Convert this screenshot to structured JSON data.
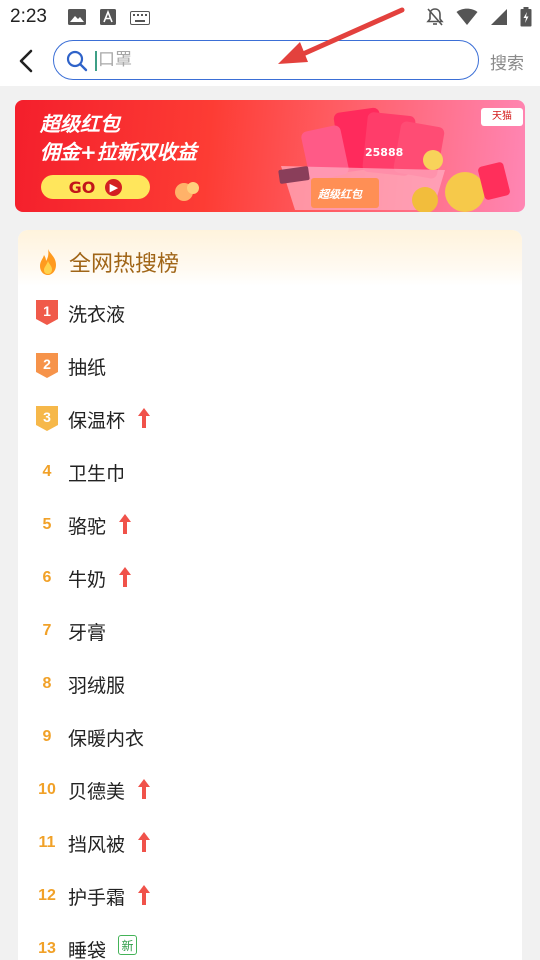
{
  "status_bar": {
    "time": "2:23",
    "left_icons": [
      "image-icon",
      "font-download-icon",
      "keyboard-icon"
    ],
    "right_icons": [
      "bell-off-icon",
      "wifi-icon",
      "signal-icon",
      "battery-charging-icon"
    ]
  },
  "top_bar": {
    "back_icon": "chevron-left-icon",
    "search_placeholder": "口罩",
    "search_value": "",
    "search_button_label": "搜索"
  },
  "banner": {
    "line1": "超级红包",
    "line2": "佣金+拉新双收益",
    "go_label": "GO",
    "amount_text": "25888",
    "cart_label": "超级红包",
    "logo_text": "天猫"
  },
  "hot_list": {
    "title": "全网热搜榜",
    "items": [
      {
        "rank": "1",
        "label": "洗衣液",
        "badge": "top",
        "trend": ""
      },
      {
        "rank": "2",
        "label": "抽纸",
        "badge": "top",
        "trend": ""
      },
      {
        "rank": "3",
        "label": "保温杯",
        "badge": "top",
        "trend": "up"
      },
      {
        "rank": "4",
        "label": "卫生巾",
        "badge": "",
        "trend": ""
      },
      {
        "rank": "5",
        "label": "骆驼",
        "badge": "",
        "trend": "up"
      },
      {
        "rank": "6",
        "label": "牛奶",
        "badge": "",
        "trend": "up"
      },
      {
        "rank": "7",
        "label": "牙膏",
        "badge": "",
        "trend": ""
      },
      {
        "rank": "8",
        "label": "羽绒服",
        "badge": "",
        "trend": ""
      },
      {
        "rank": "9",
        "label": "保暖内衣",
        "badge": "",
        "trend": ""
      },
      {
        "rank": "10",
        "label": "贝德美",
        "badge": "",
        "trend": "up"
      },
      {
        "rank": "11",
        "label": "挡风被",
        "badge": "",
        "trend": "up"
      },
      {
        "rank": "12",
        "label": "护手霜",
        "badge": "",
        "trend": "up"
      },
      {
        "rank": "13",
        "label": "睡袋",
        "badge": "",
        "trend": "new",
        "new_label": "新"
      }
    ]
  },
  "colors": {
    "accent_blue": "#3b6fd6",
    "rank_orange": "#f1a128",
    "trend_red": "#f0524a",
    "banner_red": "#f41f2c",
    "new_green": "#2e9c48"
  }
}
